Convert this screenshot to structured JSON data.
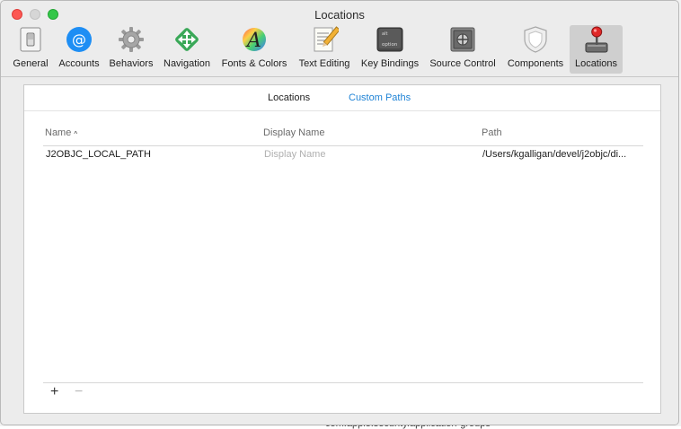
{
  "window": {
    "title": "Locations"
  },
  "toolbar": {
    "items": [
      {
        "label": "General",
        "icon": "switch-icon"
      },
      {
        "label": "Accounts",
        "icon": "at-icon"
      },
      {
        "label": "Behaviors",
        "icon": "gear-icon"
      },
      {
        "label": "Navigation",
        "icon": "move-arrows-icon"
      },
      {
        "label": "Fonts & Colors",
        "icon": "font-icon"
      },
      {
        "label": "Text Editing",
        "icon": "pencil-paper-icon"
      },
      {
        "label": "Key Bindings",
        "icon": "option-key-icon"
      },
      {
        "label": "Source Control",
        "icon": "safe-icon"
      },
      {
        "label": "Components",
        "icon": "shield-icon"
      },
      {
        "label": "Locations",
        "icon": "joystick-icon",
        "selected": true
      }
    ]
  },
  "segments": {
    "locations": "Locations",
    "custom_paths": "Custom Paths",
    "active": "Locations"
  },
  "table": {
    "columns": [
      "Name",
      "Display Name",
      "Path"
    ],
    "sort_indicator": "^",
    "rows": [
      {
        "name": "J2OBJC_LOCAL_PATH",
        "display_name_placeholder": "Display Name",
        "path": "/Users/kgalligan/devel/j2objc/di..."
      }
    ]
  },
  "buttons": {
    "add": "+",
    "remove": "−"
  },
  "backdrop": {
    "text": "com.apple.security.application-groups"
  },
  "colors": {
    "accent": "#1f83d6",
    "at_icon": "#1e8ef4",
    "close": "#fc5753",
    "zoom": "#33c748"
  }
}
